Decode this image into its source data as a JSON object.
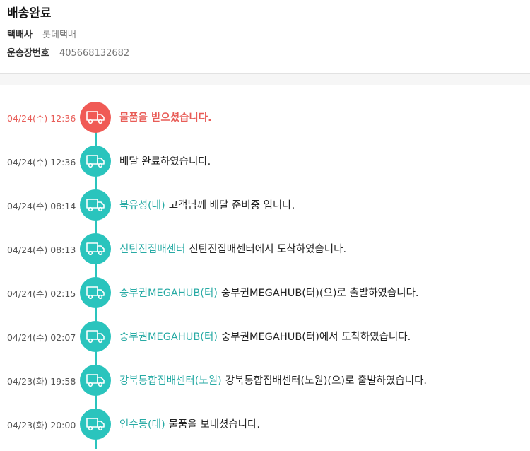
{
  "header": {
    "status": "배송완료",
    "carrier_label": "택배사",
    "carrier_value": "롯데택배",
    "tracking_label": "운송장번호",
    "tracking_value": "405668132682"
  },
  "colors": {
    "accent": "#2ac4bd",
    "latest": "#f05a55",
    "location_text": "#27aaa4"
  },
  "timeline": [
    {
      "time": "04/24(수) 12:36",
      "location": "",
      "message": "물품을 받으셨습니다.",
      "icon": "truck-icon",
      "latest": true
    },
    {
      "time": "04/24(수) 12:36",
      "location": "",
      "message": "배달 완료하였습니다.",
      "icon": "truck-icon"
    },
    {
      "time": "04/24(수) 08:14",
      "location": "북유성(대)",
      "message": "고객님께 배달 준비중 입니다.",
      "icon": "truck-icon"
    },
    {
      "time": "04/24(수) 08:13",
      "location": "신탄진집배센터",
      "message": "신탄진집배센터에서 도착하였습니다.",
      "icon": "truck-icon"
    },
    {
      "time": "04/24(수) 02:15",
      "location": "중부권MEGAHUB(터)",
      "message": "중부권MEGAHUB(터)(으)로 출발하였습니다.",
      "icon": "truck-icon"
    },
    {
      "time": "04/24(수) 02:07",
      "location": "중부권MEGAHUB(터)",
      "message": "중부권MEGAHUB(터)에서 도착하였습니다.",
      "icon": "truck-icon"
    },
    {
      "time": "04/23(화) 19:58",
      "location": "강북통합집배센터(노원)",
      "message": "강북통합집배센터(노원)(으)로 출발하였습니다.",
      "icon": "truck-icon"
    },
    {
      "time": "04/23(화) 20:00",
      "location": "인수동(대)",
      "message": "물품을 보내셨습니다.",
      "icon": "truck-icon"
    }
  ]
}
